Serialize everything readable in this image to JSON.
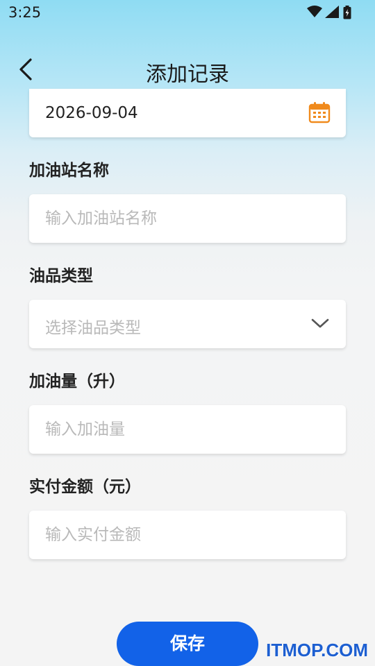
{
  "status_bar": {
    "time": "3:25"
  },
  "header": {
    "title": "添加记录"
  },
  "form": {
    "date_value": "2026-09-04",
    "station": {
      "label": "加油站名称",
      "placeholder": "输入加油站名称"
    },
    "fuel_type": {
      "label": "油品类型",
      "placeholder": "选择油品类型"
    },
    "volume": {
      "label": "加油量（升）",
      "placeholder": "输入加油量"
    },
    "amount": {
      "label": "实付金额（元）",
      "placeholder": "输入实付金额"
    }
  },
  "actions": {
    "save_label": "保存"
  },
  "watermark": "ITMOP.COM",
  "icons": [
    "wifi-icon",
    "signal-icon",
    "battery-icon",
    "back-arrow-icon",
    "calendar-icon",
    "chevron-down-icon"
  ],
  "colors": {
    "primary": "#1262e8",
    "calendar_accent": "#f08a1c",
    "placeholder": "#b9b9b9"
  }
}
